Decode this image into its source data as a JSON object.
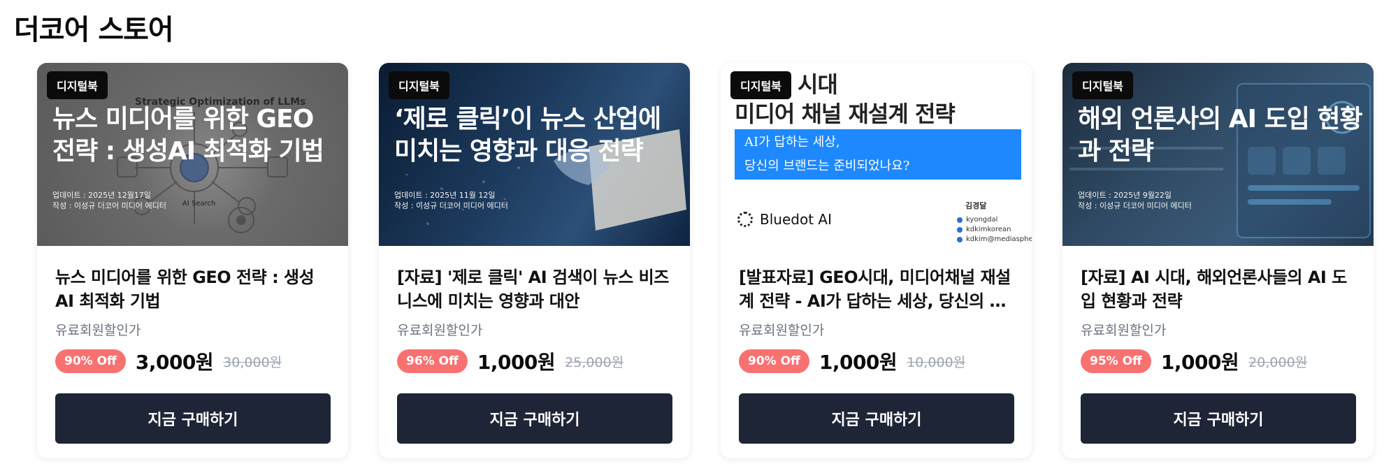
{
  "page": {
    "title": "더코어 스토어"
  },
  "badge_label": "디지털북",
  "cards": [
    {
      "thumb_title": "뉴스 미디어를 위한 GEO 전략 : 생성AI 최적화 기법",
      "thumb_subtitle": "Strategic Optimization of LLMs",
      "thumb_updated": "업데이트 : 2025년 12월17일",
      "thumb_author": "작성 : 이성규 더코어 미디어 에디터",
      "thumb_caption": "AI Search",
      "title": "뉴스 미디어를 위한 GEO 전략 : 생성 AI 최적화 기법",
      "member_label": "유료회원할인가",
      "discount": "90% Off",
      "price": "3,000원",
      "original_price": "30,000원",
      "button_label": "지금 구매하기"
    },
    {
      "thumb_title": "‘제로 클릭’이 뉴스 산업에 미치는 영향과 대응 전략",
      "thumb_updated": "업데이트 : 2025년 11월 12일",
      "thumb_author": "작성 : 이성규 더코어 미디어 에디터",
      "title": "[자료] '제로 클릭' AI 검색이 뉴스 비즈니스에 미치는 영향과 대안",
      "member_label": "유료회원할인가",
      "discount": "96% Off",
      "price": "1,000원",
      "original_price": "25,000원",
      "button_label": "지금 구매하기"
    },
    {
      "thumb_heading_1": "시대",
      "thumb_heading_2": "미디어 채널 재설계 전략",
      "thumb_blue_1": "AI가 답하는 세상,",
      "thumb_blue_2": "당신의 브랜드는 준비되었나요?",
      "thumb_logo": "Bluedot AI",
      "thumb_author_name": "김경달",
      "thumb_author_links": [
        "kyongdal",
        "kdkimkorean",
        "kdkim@mediasphere.kr"
      ],
      "title": "[발표자료] GEO시대, 미디어채널 재설계 전략 - AI가 답하는 세상, 당신의 브랜드는 준비되었나요?",
      "member_label": "유료회원할인가",
      "discount": "90% Off",
      "price": "1,000원",
      "original_price": "10,000원",
      "button_label": "지금 구매하기"
    },
    {
      "thumb_title": "해외 언론사의 AI 도입 현황과 전략",
      "thumb_updated": "업데이트 : 2025년 9월22일",
      "thumb_author": "작성 : 이성규 더코어 미디어 에디터",
      "title": "[자료] AI 시대, 해외언론사들의 AI 도입 현황과 전략",
      "member_label": "유료회원할인가",
      "discount": "95% Off",
      "price": "1,000원",
      "original_price": "20,000원",
      "button_label": "지금 구매하기"
    }
  ],
  "colors": {
    "accent_discount": "#f87171",
    "button_bg": "#1e2536",
    "blue_box": "#1e88ff"
  }
}
